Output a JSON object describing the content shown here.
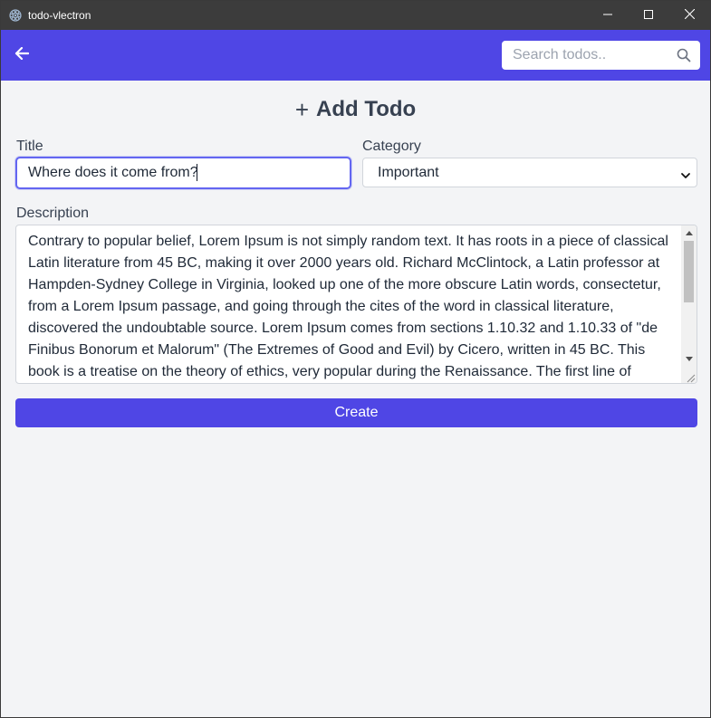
{
  "window": {
    "title": "todo-vlectron",
    "controls": [
      "minimize-icon",
      "maximize-icon",
      "close-icon"
    ]
  },
  "navbar": {
    "back_icon": "arrow-left-icon",
    "search": {
      "placeholder": "Search todos..",
      "value": "",
      "icon": "search-icon"
    },
    "color": "#4f46e5"
  },
  "form": {
    "heading_icon": "+",
    "heading": "Add Todo",
    "title_label": "Title",
    "title_value": "Where does it come from?",
    "category_label": "Category",
    "category_value": "Important",
    "description_label": "Description",
    "description_value": "Contrary to popular belief, Lorem Ipsum is not simply random text. It has roots in a piece of classical Latin literature from 45 BC, making it over 2000 years old. Richard McClintock, a Latin professor at Hampden-Sydney College in Virginia, looked up one of the more obscure Latin words, consectetur, from a Lorem Ipsum passage, and going through the cites of the word in classical literature, discovered the undoubtable source. Lorem Ipsum comes from sections 1.10.32 and 1.10.33 of \"de Finibus Bonorum et Malorum\" (The Extremes of Good and Evil) by Cicero, written in 45 BC. This book is a treatise on the theory of ethics, very popular during the Renaissance. The first line of",
    "submit_label": "Create"
  },
  "colors": {
    "accent": "#4f46e5",
    "focus_border": "#6366f1",
    "background": "#f3f4f6",
    "titlebar": "#3c3c3c"
  }
}
